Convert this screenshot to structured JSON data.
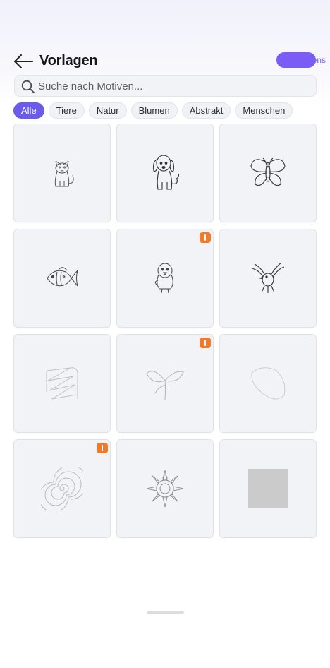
{
  "header": {
    "title": "Vorlagen",
    "back_icon": "arrow-left-icon",
    "pro_pill_color": "#7b5cf5",
    "pro_tail_text": "ens"
  },
  "search": {
    "placeholder": "Suche nach Motiven...",
    "value": "",
    "icon": "search-icon"
  },
  "filters": {
    "items": [
      "Alle",
      "Tiere",
      "Natur",
      "Blumen",
      "Abstrakt",
      "Menschen"
    ],
    "active": "Alle",
    "active_color": "#6b5bea"
  },
  "templates": [
    {
      "motif": "cat",
      "premium": false
    },
    {
      "motif": "dog",
      "premium": false
    },
    {
      "motif": "butterfly",
      "premium": false
    },
    {
      "motif": "fish",
      "premium": false
    },
    {
      "motif": "chick",
      "premium": true
    },
    {
      "motif": "bird",
      "premium": false
    },
    {
      "motif": "abstract-lines",
      "premium": false
    },
    {
      "motif": "sprout",
      "premium": true
    },
    {
      "motif": "leaf",
      "premium": false
    },
    {
      "motif": "spiral",
      "premium": true
    },
    {
      "motif": "mandala",
      "premium": false
    },
    {
      "motif": "gray-square",
      "premium": false
    }
  ],
  "badge_color": "#f07a2c"
}
